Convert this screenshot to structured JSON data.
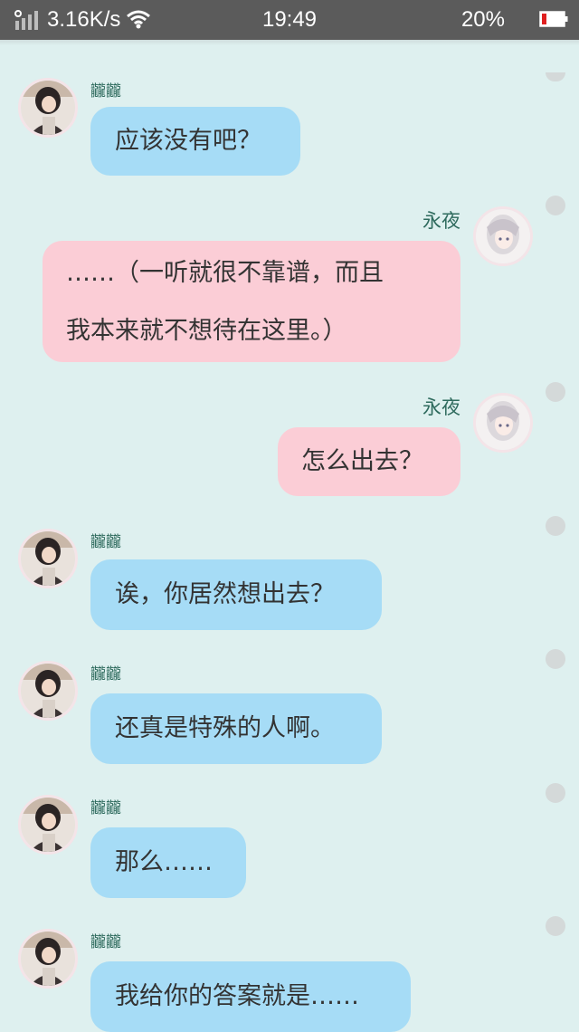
{
  "status_bar": {
    "net_speed": "3.16K/s",
    "time": "19:49",
    "battery": "20%"
  },
  "messages": [
    {
      "side": "left",
      "sender": "龖龖",
      "text": "应该没有吧？"
    },
    {
      "side": "right",
      "sender": "永夜",
      "text": "……（一听就很不靠谱，而且",
      "text_line2": "我本来就不想待在这里。）"
    },
    {
      "side": "right",
      "sender": "永夜",
      "text": "怎么出去？"
    },
    {
      "side": "left",
      "sender": "龖龖",
      "text": "诶，你居然想出去？"
    },
    {
      "side": "left",
      "sender": "龖龖",
      "text": "还真是特殊的人啊。"
    },
    {
      "side": "left",
      "sender": "龖龖",
      "text": "那么……"
    },
    {
      "side": "left",
      "sender": "龖龖",
      "text": "我给你的答案就是……"
    }
  ],
  "colors": {
    "background": "#def0ef",
    "left_bubble": "#a6dcf6",
    "right_bubble": "#fbcdd6",
    "name": "#2f6b5e"
  },
  "icons": {
    "signal": "signal-icon",
    "wifi": "wifi-icon",
    "battery": "battery-icon",
    "avatar_left": "avatar-dark-hair",
    "avatar_right": "avatar-white-hair"
  }
}
